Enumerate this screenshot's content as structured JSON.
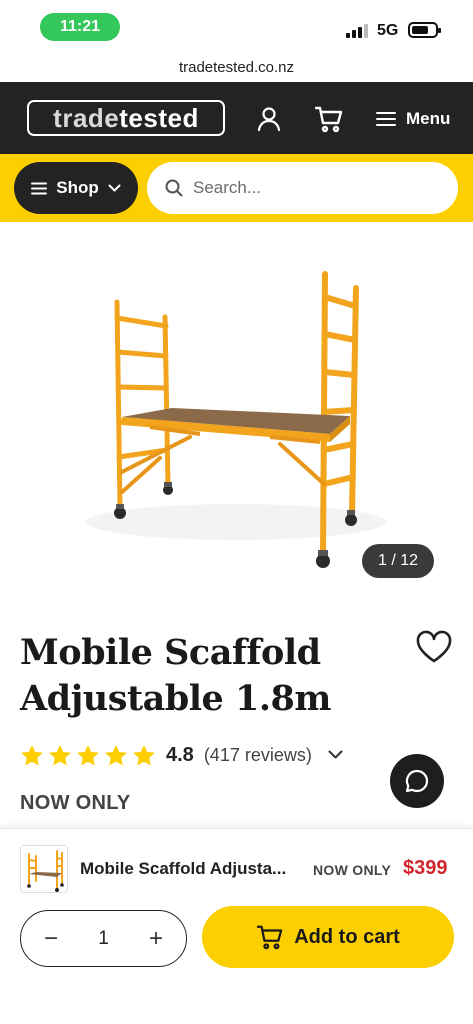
{
  "status_bar": {
    "time": "11:21",
    "network": "5G",
    "time_pill_color": "#34c759"
  },
  "browser": {
    "url": "tradetested.co.nz"
  },
  "header": {
    "logo_part1": "trade",
    "logo_part2": "tested",
    "account_icon": "user-icon",
    "cart_icon": "cart-icon",
    "menu_label": "Menu",
    "background_color": "#232323"
  },
  "shop_bar": {
    "shop_label": "Shop",
    "search_placeholder": "Search...",
    "background_color": "#fcd000"
  },
  "product": {
    "image_counter": "1 / 12",
    "title": "Mobile Scaffold Adjustable 1.8m",
    "rating_value": "4.8",
    "stars": 5,
    "reviews_text": "(417 reviews)",
    "price_label": "NOW ONLY"
  },
  "sticky_bar": {
    "product_name": "Mobile Scaffold Adjusta...",
    "now_only": "NOW ONLY",
    "price": "$399",
    "price_color": "#d2262f",
    "quantity": "1",
    "minus_label": "−",
    "plus_label": "+",
    "add_to_cart_label": "Add to cart"
  }
}
